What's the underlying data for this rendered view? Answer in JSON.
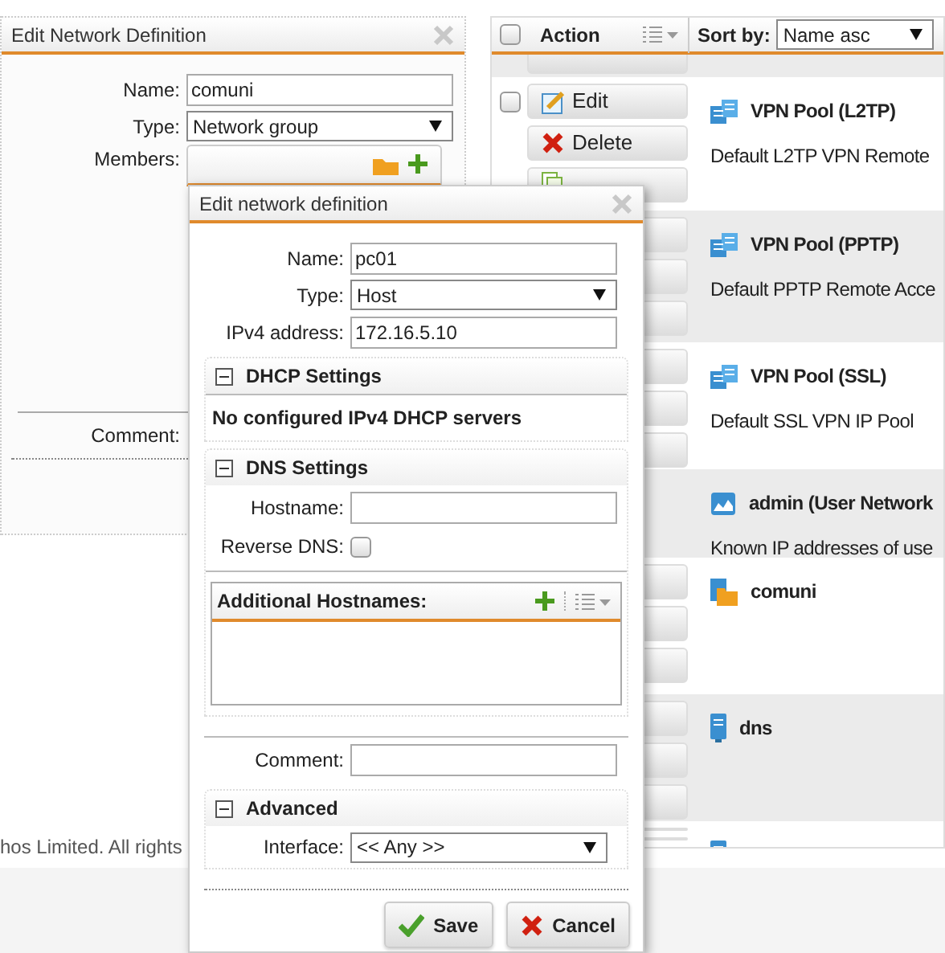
{
  "network_definition_panel": {
    "title": "Edit Network Definition",
    "fields": [
      {
        "label": "Name:",
        "value": "comuni",
        "kind": "text"
      },
      {
        "label": "Type:",
        "value": "Network group",
        "kind": "select"
      },
      {
        "label": "Members:",
        "kind": "members"
      }
    ],
    "comment_label": "Comment:"
  },
  "list": {
    "header": {
      "select_all_checked": false,
      "action_label": "Action",
      "sort_label": "Sort by:",
      "sort_value": "Name asc"
    },
    "rows": [
      {
        "kind": "vpn",
        "name": "VPN Pool (L2TP)",
        "description": "Default L2TP VPN Remote",
        "checked": false,
        "buttons": [
          {
            "label": "Edit",
            "kind": "edit"
          },
          {
            "label": "Delete",
            "kind": "delete"
          },
          {
            "kind": "clone"
          }
        ]
      },
      {
        "kind": "vpn",
        "name": "VPN Pool (PPTP)",
        "description": "Default PPTP Remote Acce"
      },
      {
        "kind": "vpn",
        "name": "VPN Pool (SSL)",
        "description": "Default SSL VPN IP Pool"
      },
      {
        "kind": "user_network",
        "name": "admin (User Network",
        "description": "Known IP addresses of use"
      },
      {
        "kind": "group",
        "name": "comuni"
      },
      {
        "kind": "host",
        "name": "dns"
      },
      {
        "kind": "host"
      }
    ]
  },
  "dialog": {
    "title": "Edit network definition",
    "fields": [
      {
        "label": "Name:",
        "value": "pc01",
        "kind": "text"
      },
      {
        "label": "Type:",
        "value": "Host",
        "kind": "select"
      },
      {
        "label": "IPv4 address:",
        "value": "172.16.5.10",
        "kind": "text"
      }
    ],
    "dhcp": {
      "title": "DHCP Settings",
      "expanded": true,
      "message": "No configured IPv4 DHCP servers"
    },
    "dns": {
      "title": "DNS Settings",
      "expanded": true,
      "hostname_label": "Hostname:",
      "reverse_dns_label": "Reverse DNS:",
      "reverse_dns_checked": false,
      "additional_hostnames_label": "Additional Hostnames:"
    },
    "comment_label": "Comment:",
    "advanced": {
      "title": "Advanced",
      "expanded": true,
      "interface_label": "Interface:",
      "interface_value": "<< Any >>"
    },
    "buttons": [
      {
        "label": "Save",
        "kind": "save"
      },
      {
        "label": "Cancel",
        "kind": "cancel"
      }
    ]
  },
  "footer": "hos Limited. All rights"
}
